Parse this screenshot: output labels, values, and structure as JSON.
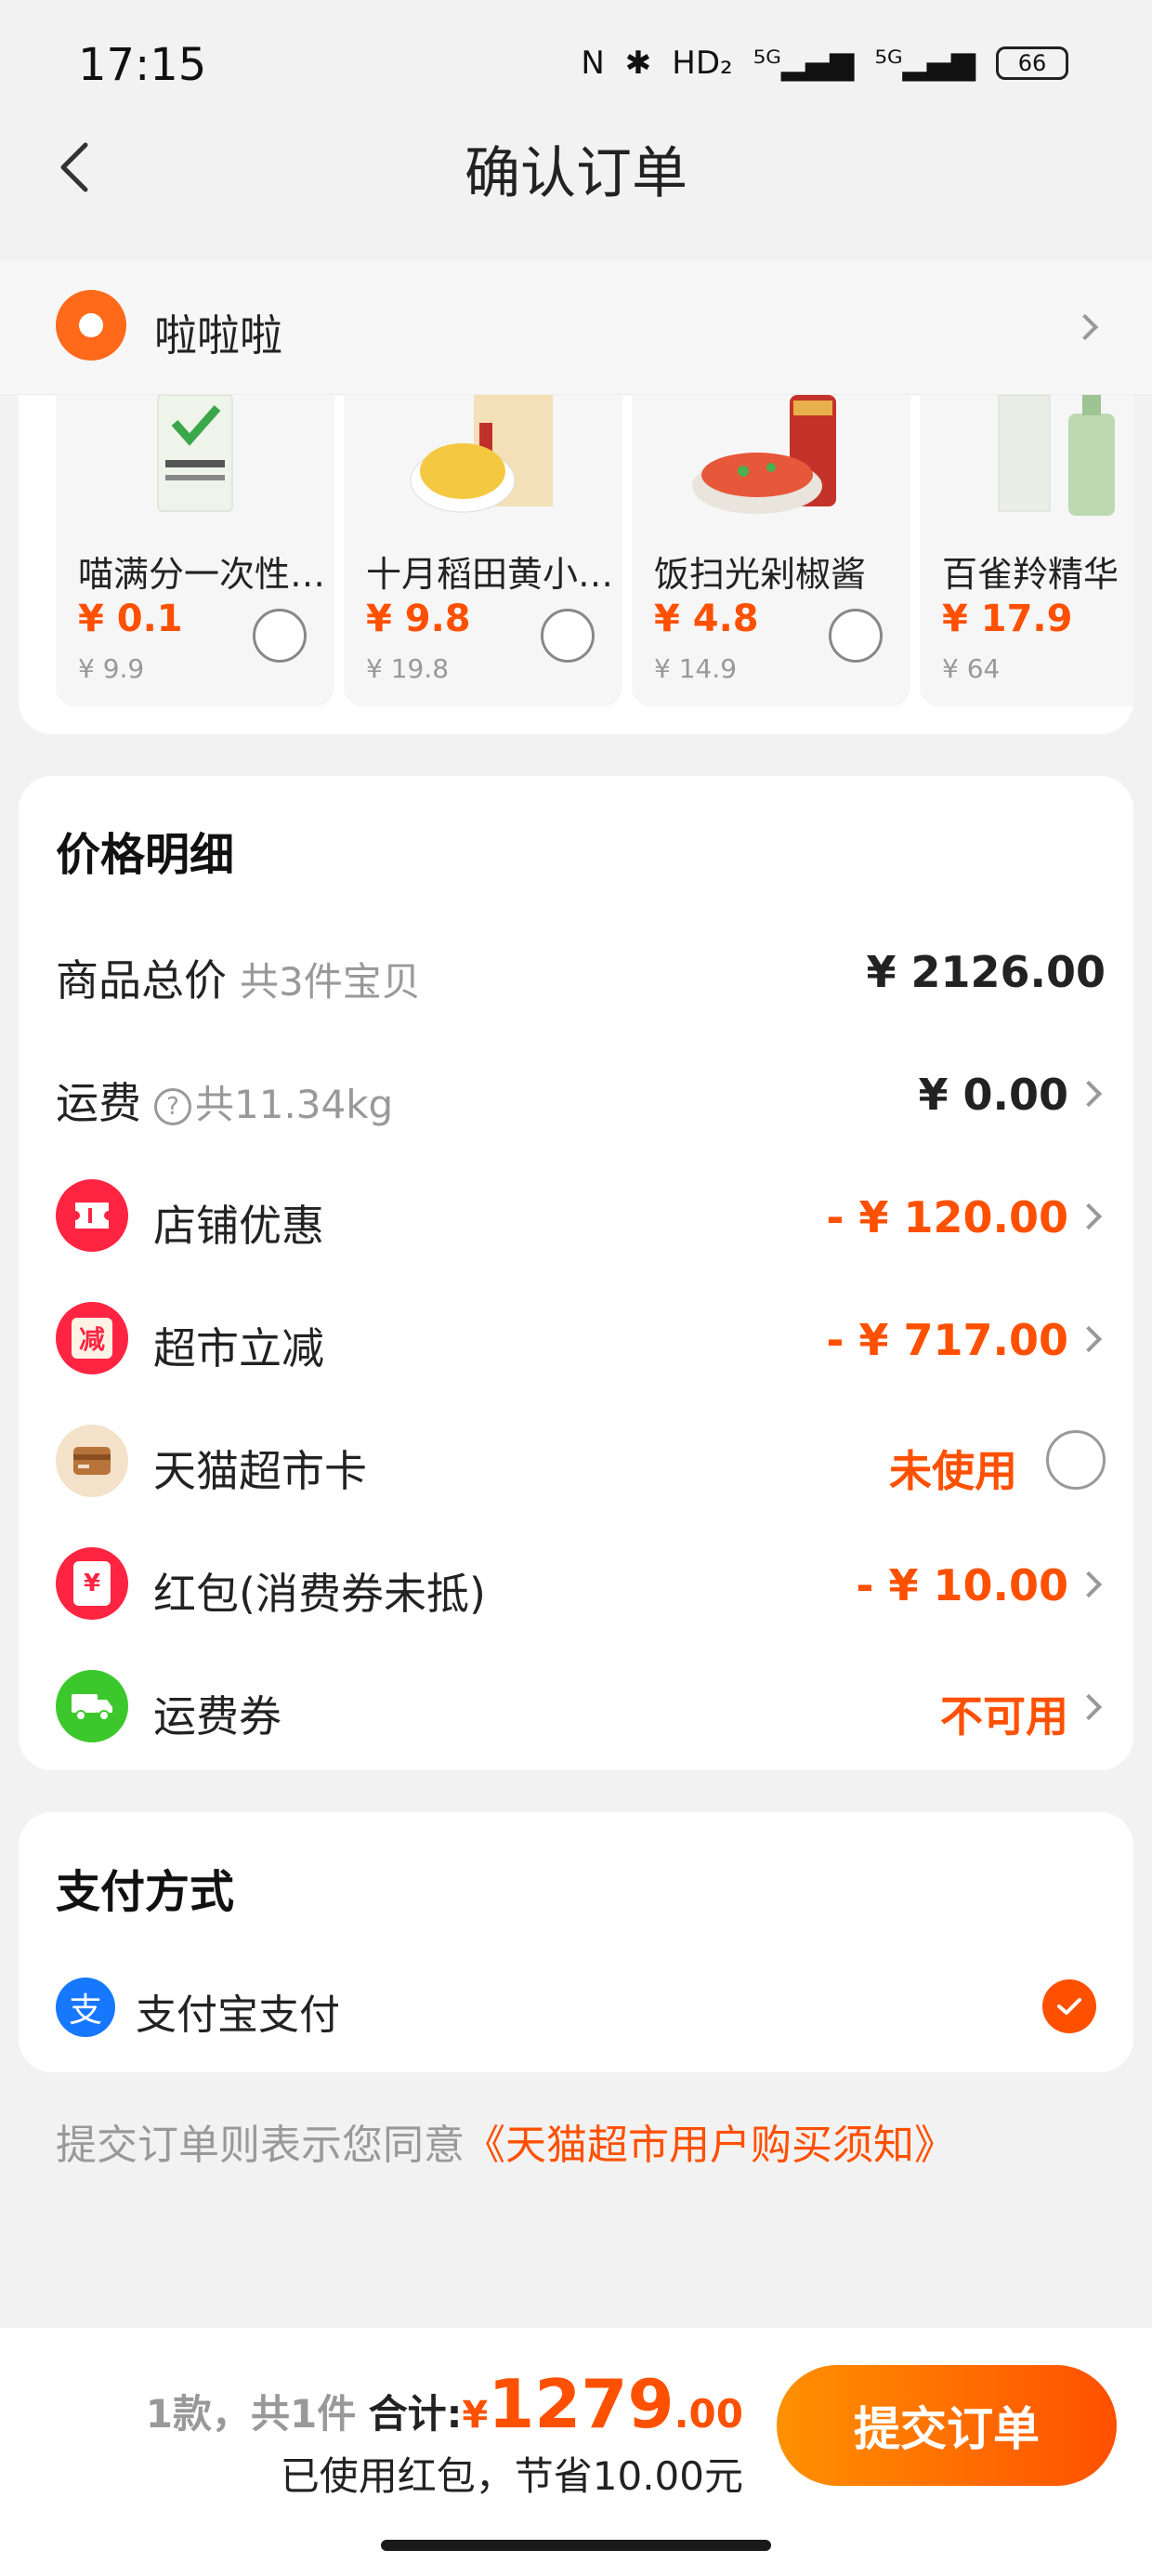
{
  "status_bar": {
    "time": "17:15",
    "icons": [
      "N",
      "✱",
      "HD₂",
      "⁵ᴳ▂▄▆",
      "⁵ᴳ▂▄▆"
    ],
    "battery": "66"
  },
  "header": {
    "title": "确认订单"
  },
  "address": {
    "name": "啦啦啦"
  },
  "products": [
    {
      "name": "喵满分一次性…",
      "price": "¥ 0.1",
      "original": "¥ 9.9",
      "img_color": "#e8f0e0"
    },
    {
      "name": "十月稻田黄小…",
      "price": "¥ 9.8",
      "original": "¥ 19.8",
      "img_color": "#f5c842"
    },
    {
      "name": "饭扫光剁椒酱",
      "price": "¥ 4.8",
      "original": "¥ 14.9",
      "img_color": "#e7573a"
    },
    {
      "name": "百雀羚精华",
      "price": "¥ 17.9",
      "original": "¥ 64",
      "img_color": "#cfe3c8"
    }
  ],
  "price_detail": {
    "title": "价格明细",
    "total": {
      "label": "商品总价",
      "sub": "共3件宝贝",
      "value": "¥ 2126.00"
    },
    "shipping": {
      "label": "运费",
      "qmark": "?",
      "sub": "共11.34kg",
      "value": "¥ 0.00"
    },
    "shop_discount": {
      "label": "店铺优惠",
      "value": "- ¥ 120.00",
      "icon": "ticket-icon",
      "icon_color": "#ff2442"
    },
    "market_discount": {
      "label": "超市立减",
      "value": "- ¥ 717.00",
      "icon": "discount-icon",
      "icon_glyph": "减",
      "icon_color": "#ff2442"
    },
    "market_card": {
      "label": "天猫超市卡",
      "value": "未使用",
      "icon": "card-icon",
      "icon_color": "#f3e2c9"
    },
    "red_packet": {
      "label": "红包(消费券未抵)",
      "value": "- ¥ 10.00",
      "icon": "red-packet-icon",
      "icon_glyph": "¥",
      "icon_color": "#ff2442"
    },
    "shipping_coupon": {
      "label": "运费券",
      "value": "不可用",
      "icon": "truck-icon",
      "icon_color": "#3cc82d"
    }
  },
  "payment": {
    "title": "支付方式",
    "method": "支付宝支付",
    "icon_glyph": "支"
  },
  "agreement": {
    "prefix": "提交订单则表示您同意",
    "link": "《天猫超市用户购买须知》"
  },
  "bottom": {
    "count": "1款，共1件",
    "sum_label": "合计:",
    "yen": "¥",
    "amount_int": "1279",
    "amount_dec": ".00",
    "saved": "已使用红包，节省10.00元",
    "submit": "提交订单"
  },
  "colors": {
    "accent": "#ff5000",
    "red": "#ff2442",
    "green": "#3cc82d",
    "alipay": "#1677ff"
  }
}
